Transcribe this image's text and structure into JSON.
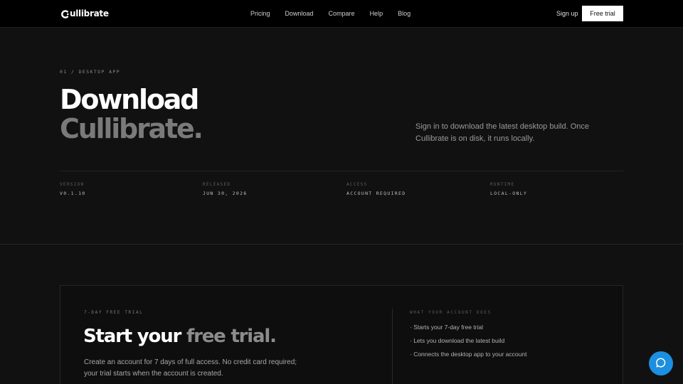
{
  "nav": {
    "logo_text": "ullibrate",
    "links": [
      "Pricing",
      "Download",
      "Compare",
      "Help",
      "Blog"
    ],
    "signup_label": "Sign up",
    "free_trial_label": "Free trial"
  },
  "hero": {
    "eyebrow": "01 / DESKTOP APP",
    "title_line1": "Download",
    "title_line2": "Cullibrate.",
    "subtitle": "Sign in to download the latest desktop build. Once Cullibrate is on disk, it runs locally."
  },
  "meta": [
    {
      "key": "VERSION",
      "value": "V0.1.10"
    },
    {
      "key": "RELEASED",
      "value": "JUN 30, 2026"
    },
    {
      "key": "ACCESS",
      "value": "ACCOUNT REQUIRED"
    },
    {
      "key": "RUNTIME",
      "value": "LOCAL-ONLY"
    }
  ],
  "trial": {
    "eyebrow": "7-DAY FREE TRIAL",
    "title_start": "Start your ",
    "title_muted": "free trial.",
    "body": "Create an account for 7 days of full access. No credit card required; your trial starts when the account is created."
  },
  "account": {
    "eyebrow": "WHAT YOUR ACCOUNT DOES",
    "items": [
      "· Starts your 7-day free trial",
      "· Lets you download the latest build",
      "· Connects the desktop app to your account"
    ]
  },
  "colors": {
    "background": "#111111",
    "nav_background": "#000000",
    "chat_accent": "#1d8fe0"
  },
  "icons": {
    "logo": "cullibrate-logo-icon",
    "chat": "chat-bubble-icon"
  }
}
